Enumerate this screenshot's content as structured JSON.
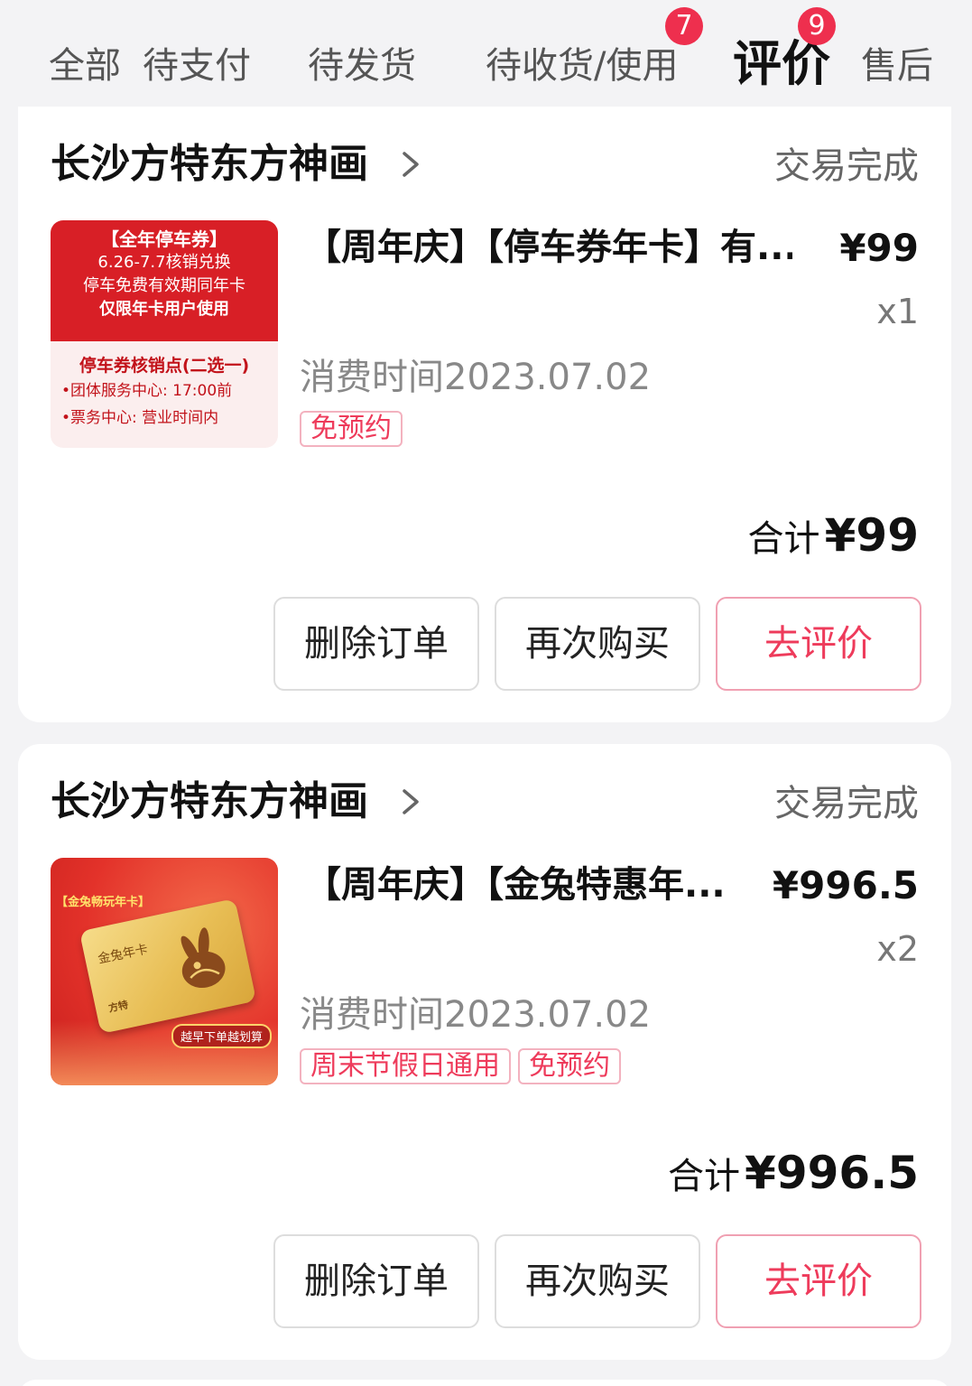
{
  "tabs": {
    "items": [
      {
        "label": "全部"
      },
      {
        "label": "待支付"
      },
      {
        "label": "待发货"
      },
      {
        "label": "待收货/使用",
        "badge": "7"
      },
      {
        "label": "评价",
        "badge": "9"
      },
      {
        "label": "售后"
      }
    ],
    "active_index": 4
  },
  "colors": {
    "accent": "#ee3b5b",
    "badge": "#ee2f4e",
    "background": "#f3f3f5"
  },
  "orders": [
    {
      "store": "长沙方特东方神画",
      "status": "交易完成",
      "product_title": "【周年庆】【停车券年卡】有...",
      "price": "¥99",
      "qty": "x1",
      "consume_time": "消费时间2023.07.02",
      "tags": [
        "免预约"
      ],
      "total_label": "合计",
      "total_amount": "¥99",
      "thumb": {
        "line1": "【全年停车券】",
        "line2": "6.26-7.7核销兑换",
        "line3": "停车免费有效期同年卡",
        "line4": "仅限年卡用户使用",
        "header": "停车券核销点(二选一)",
        "row1": "•团体服务中心: 17:00前",
        "row2": "•票务中心: 营业时间内"
      },
      "actions": {
        "delete": "删除订单",
        "rebuy": "再次购买",
        "review": "去评价"
      }
    },
    {
      "store": "长沙方特东方神画",
      "status": "交易完成",
      "product_title": "【周年庆】【金兔特惠年...",
      "price": "¥996.5",
      "qty": "x2",
      "consume_time": "消费时间2023.07.02",
      "tags": [
        "周末节假日通用",
        "免预约"
      ],
      "total_label": "合计",
      "total_amount": "¥996.5",
      "thumb": {
        "label": "【金兔畅玩年卡】",
        "card_text": "金兔年卡",
        "brand": "方特",
        "pill": "越早下单越划算"
      },
      "actions": {
        "delete": "删除订单",
        "rebuy": "再次购买",
        "review": "去评价"
      }
    }
  ]
}
